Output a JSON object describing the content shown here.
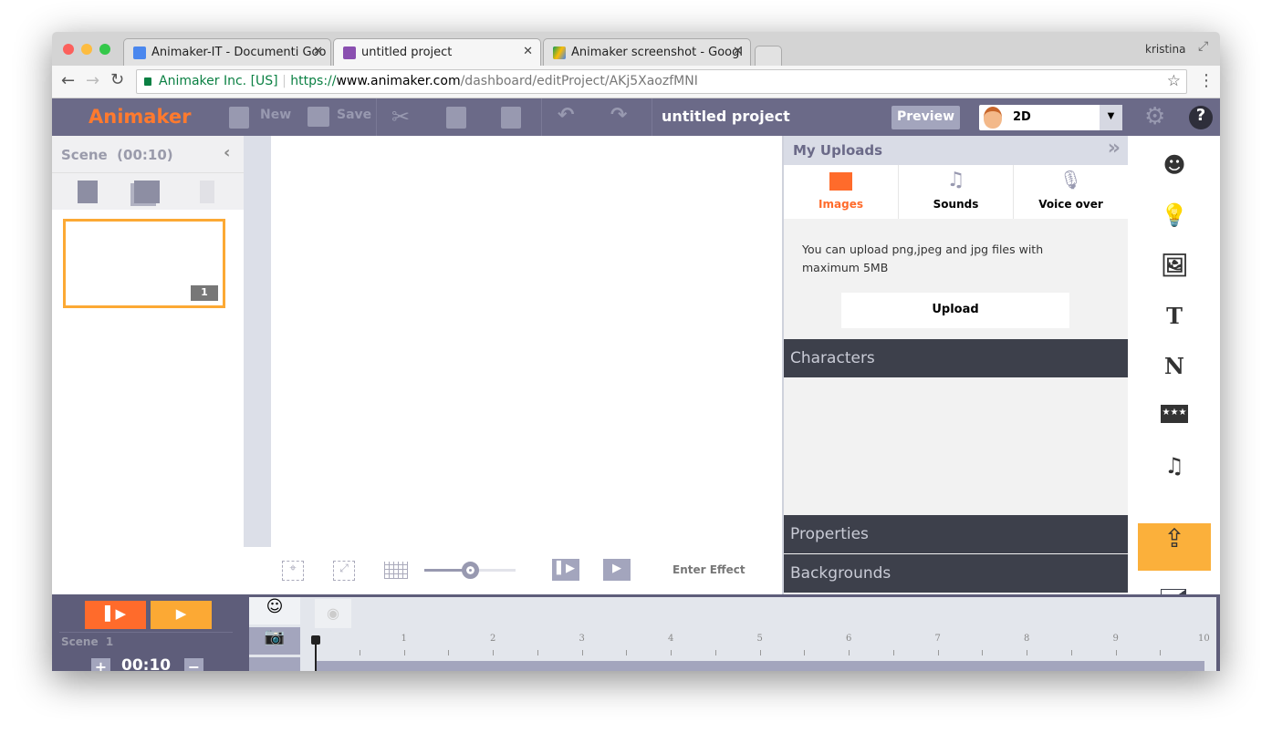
{
  "browser": {
    "tabs": [
      {
        "title": "Animaker-IT - Documenti Goo"
      },
      {
        "title": "untitled project"
      },
      {
        "title": "Animaker screenshot - Googl"
      }
    ],
    "user": "kristina",
    "secure_label": "Animaker Inc. [US]",
    "url_scheme": "https://",
    "url_host": "www.animaker.com",
    "url_path": "/dashboard/editProject/AKj5XaozfMNI"
  },
  "toolbar": {
    "logo": "Animaker",
    "new": "New",
    "save": "Save",
    "project_title": "untitled project",
    "preview": "Preview",
    "mode": "2D"
  },
  "scenes": {
    "header": "Scene  (00:10)",
    "thumb_number": "1"
  },
  "canvas": {
    "enter_effect": "Enter Effect",
    "zoom_level": 0.5
  },
  "uploads": {
    "title": "My Uploads",
    "tabs": [
      {
        "label": "Images"
      },
      {
        "label": "Sounds"
      },
      {
        "label": "Voice over"
      }
    ],
    "info": "You can upload png,jpeg and jpg files with maximum 5MB",
    "upload_button": "Upload",
    "sections": [
      "Characters",
      "Properties",
      "Backgrounds"
    ]
  },
  "timeline": {
    "scene_label": "Scene  1",
    "duration": "00:10",
    "ticks": [
      "1",
      "2",
      "3",
      "4",
      "5",
      "6",
      "7",
      "8",
      "9",
      "10"
    ]
  },
  "colors": {
    "accent_orange": "#ff6b2b",
    "accent_yellow": "#fbb03b",
    "toolbar": "#6b6a88",
    "dark_bar": "#3d404b"
  }
}
